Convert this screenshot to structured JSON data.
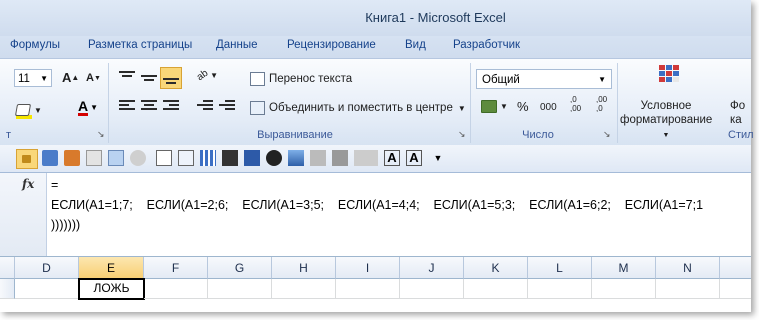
{
  "window": {
    "title": "Книга1  -  Microsoft Excel"
  },
  "tabs": [
    "Формулы",
    "Разметка страницы",
    "Данные",
    "Рецензирование",
    "Вид",
    "Разработчик"
  ],
  "ribbon": {
    "font_size": "11",
    "wrap_text": "Перенос текста",
    "merge_center": "Объединить и поместить в центре",
    "number_format": "Общий",
    "conditional_formatting_line1": "Условное",
    "conditional_formatting_line2": "форматирование",
    "format_as_table_line1": "Фо",
    "format_as_table_line2": "ка",
    "styles_partial": "Стил",
    "group_font_partial": "т",
    "group_alignment": "Выравнивание",
    "group_number": "Число",
    "percent": "%",
    "thousands": "000",
    "inc_decimal": ",0\n,00",
    "dec_decimal": ",00\n,0"
  },
  "formula_bar": {
    "fx": "fx",
    "lines": [
      "=",
      "ЕСЛИ(A1=1;7;    ЕСЛИ(A1=2;6;    ЕСЛИ(A1=3;5;    ЕСЛИ(A1=4;4;    ЕСЛИ(A1=5;3;    ЕСЛИ(A1=6;2;    ЕСЛИ(A1=7;1",
      ")))))))"
    ]
  },
  "grid": {
    "columns": [
      "D",
      "E",
      "F",
      "G",
      "H",
      "I",
      "J",
      "K",
      "L",
      "M",
      "N"
    ],
    "selected_column": "E",
    "active_cell_value": "ЛОЖЬ"
  },
  "colors": {
    "tab_text": "#15428b",
    "selected_header": "#f8cf74",
    "highlight_button": "#f9d779"
  }
}
